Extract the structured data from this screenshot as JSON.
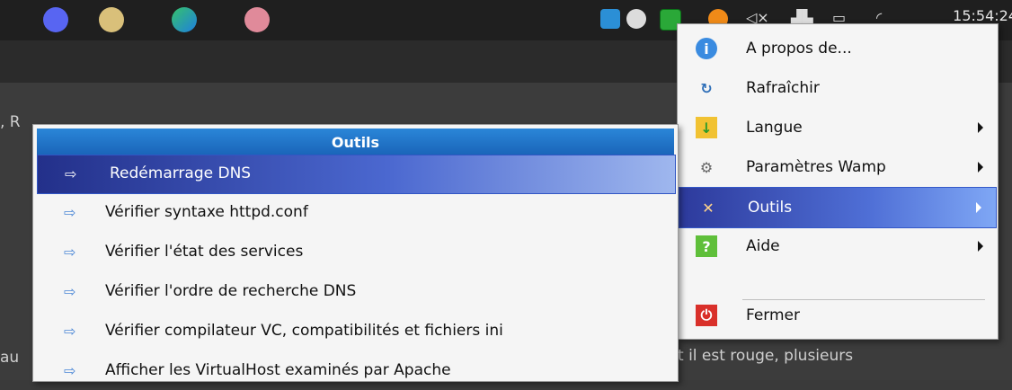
{
  "taskbar": {
    "clock": "15:54:24",
    "apps": [
      "discord-icon",
      "paint-icon",
      "edge-icon",
      "brain-icon"
    ],
    "tray": [
      "app-icon-1",
      "discord-icon",
      "wamp-icon",
      "orange-icon",
      "volume-icon",
      "network-icon",
      "battery-icon",
      "wifi-icon"
    ]
  },
  "background": {
    "left_fragment_top": ", R",
    "left_fragment_bottom": "au",
    "right_fragment_bottom": "t il est rouge, plusieurs"
  },
  "menu_right": {
    "items": [
      {
        "label": "A propos de...",
        "icon": "info-icon"
      },
      {
        "label": "Rafraîchir",
        "icon": "refresh-icon"
      },
      {
        "label": "Langue",
        "icon": "language-icon"
      },
      {
        "label": "Paramètres Wamp",
        "icon": "settings-icon"
      },
      {
        "label": "Outils",
        "icon": "tools-icon"
      },
      {
        "label": "Aide",
        "icon": "help-icon"
      },
      {
        "label": "Fermer",
        "icon": "power-icon"
      }
    ]
  },
  "menu_left": {
    "title": "Outils",
    "items": [
      {
        "label": "Redémarrage DNS"
      },
      {
        "label": "Vérifier syntaxe httpd.conf"
      },
      {
        "label": "Vérifier l'état des services"
      },
      {
        "label": "Vérifier l'ordre de recherche DNS"
      },
      {
        "label": "Vérifier compilateur VC, compatibilités et fichiers ini"
      },
      {
        "label": "Afficher les VirtualHost examinés par Apache"
      }
    ]
  },
  "colors": {
    "taskbar": "#1f1f1f",
    "menu_bg": "#f5f5f5",
    "header_blue": "#1a64b8",
    "selection_blue": "#4b68d0"
  }
}
